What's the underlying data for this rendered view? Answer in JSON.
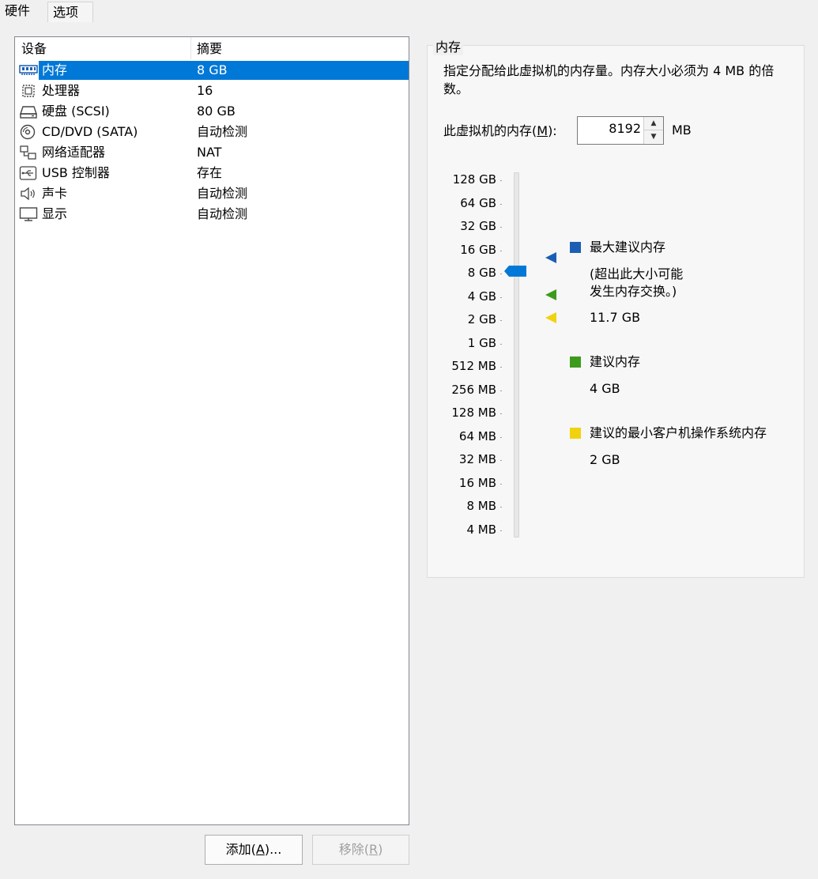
{
  "tabs": [
    "硬件",
    "选项"
  ],
  "devices": {
    "col_device": "设备",
    "col_summary": "摘要",
    "items": [
      {
        "icon": "memory-icon",
        "name": "内存",
        "summary": "8 GB"
      },
      {
        "icon": "cpu-icon",
        "name": "处理器",
        "summary": "16"
      },
      {
        "icon": "hard-disk-icon",
        "name": "硬盘 (SCSI)",
        "summary": "80 GB"
      },
      {
        "icon": "cd-dvd-icon",
        "name": "CD/DVD (SATA)",
        "summary": "自动检测"
      },
      {
        "icon": "network-adapter-icon",
        "name": "网络适配器",
        "summary": "NAT"
      },
      {
        "icon": "usb-icon",
        "name": "USB 控制器",
        "summary": "存在"
      },
      {
        "icon": "speaker-icon",
        "name": "声卡",
        "summary": "自动检测"
      },
      {
        "icon": "monitor-icon",
        "name": "显示",
        "summary": "自动检测"
      }
    ]
  },
  "buttons": {
    "add": {
      "pre": "添加(",
      "key": "A",
      "post": ")..."
    },
    "remove": {
      "pre": "移除(",
      "key": "R",
      "post": ")"
    }
  },
  "memory": {
    "group_title": "内存",
    "description": "指定分配给此虚拟机的内存量。内存大小必须为 4 MB 的倍数。",
    "label_pre": "此虚拟机的内存(",
    "label_key": "M",
    "label_post": "):",
    "value": "8192",
    "unit": "MB",
    "scale_ticks": [
      "128 GB",
      "64 GB",
      "32 GB",
      "16 GB",
      "8 GB",
      "4 GB",
      "2 GB",
      "1 GB",
      "512 MB",
      "256 MB",
      "128 MB",
      "64 MB",
      "32 MB",
      "16 MB",
      "8 MB",
      "4 MB"
    ],
    "current_tick": "8 GB",
    "legend": {
      "max": {
        "title": "最大建议内存",
        "note1": "(超出此大小可能",
        "note2": "发生内存交换。)",
        "value": "11.7 GB",
        "color": "#1a5fb4"
      },
      "recommended": {
        "title": "建议内存",
        "value": "4 GB",
        "color": "#3d9b1c"
      },
      "min": {
        "title": "建议的最小客户机操作系统内存",
        "value": "2 GB",
        "color": "#f1d20f"
      }
    }
  }
}
